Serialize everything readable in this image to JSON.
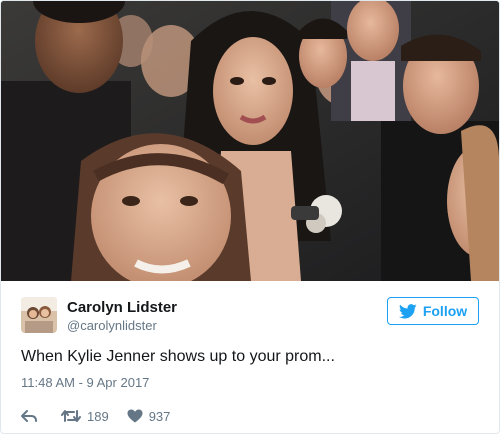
{
  "tweet": {
    "author": {
      "display_name": "Carolyn Lidster",
      "screen_name": "@carolynlidster"
    },
    "follow_label": "Follow",
    "text": "When Kylie Jenner shows up to your prom...",
    "timestamp": "11:48 AM - 9 Apr 2017",
    "retweet_count": "189",
    "like_count": "937"
  },
  "colors": {
    "accent": "#1da1f2",
    "secondary_text": "#657786",
    "border": "#e1e8ed"
  },
  "icons": {
    "follow": "twitter-bird-icon",
    "reply": "reply-icon",
    "retweet": "retweet-icon",
    "like": "heart-icon"
  }
}
